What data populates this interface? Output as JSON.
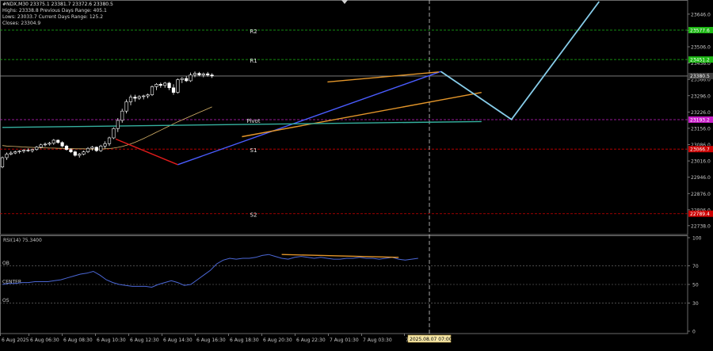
{
  "header": {
    "symbol_line": "#NDX,M30  23375.1  23381.7  23372.6  23380.5",
    "row2": "Highs: 23338.8     Previous Days Range: 405.1",
    "row3": "Lows: 23033.7      Current Days Range: 125.2",
    "row4": "Closes: 23304.9"
  },
  "chart_data": [
    {
      "type": "candlestick",
      "title": "#NDX,M30",
      "ylim": [
        22700,
        23700
      ],
      "y_ticks": [
        23646.0,
        23576.0,
        23506.0,
        23436.0,
        23366.0,
        23296.0,
        23226.0,
        23156.0,
        23086.0,
        23016.0,
        22946.0,
        22876.0,
        22806.0,
        22738.0
      ],
      "x_tick_labels": [
        "6 Aug 2025",
        "6 Aug 06:30",
        "6 Aug 08:30",
        "6 Aug 10:30",
        "6 Aug 12:30",
        "6 Aug 14:30",
        "6 Aug 16:30",
        "6 Aug 18:30",
        "6 Aug 20:30",
        "6 Aug 22:30",
        "7 Aug 01:30",
        "7 Aug 03:30",
        "7"
      ],
      "crosshair_time_label": "2025.08.07 07:00",
      "price_tags": [
        {
          "value": "23577.6",
          "color": "#1db814"
        },
        {
          "value": "23451.2",
          "color": "#1db814"
        },
        {
          "value": "23380.5",
          "color": "#3c3c3c"
        },
        {
          "value": "23193.2",
          "color": "#c71ec7"
        },
        {
          "value": "23066.7",
          "color": "#cc0000"
        },
        {
          "value": "22789.4",
          "color": "#cc0000"
        }
      ],
      "levels": [
        {
          "name": "R2",
          "value": 23577.6,
          "color": "#1db814"
        },
        {
          "name": "R1",
          "value": 23451.2,
          "color": "#1db814"
        },
        {
          "name": "Pivot",
          "value": 23193.2,
          "color": "#c71ec7"
        },
        {
          "name": "S1",
          "value": 23066.7,
          "color": "#cc0000"
        },
        {
          "name": "S2",
          "value": 22789.4,
          "color": "#cc0000"
        }
      ],
      "current_price": 23380.5,
      "candles": [
        [
          22990,
          23035,
          22985,
          23030
        ],
        [
          23030,
          23052,
          23020,
          23045
        ],
        [
          23045,
          23058,
          23040,
          23050
        ],
        [
          23050,
          23060,
          23045,
          23055
        ],
        [
          23055,
          23062,
          23048,
          23058
        ],
        [
          23058,
          23066,
          23050,
          23062
        ],
        [
          23062,
          23070,
          23055,
          23060
        ],
        [
          23060,
          23068,
          23052,
          23065
        ],
        [
          23065,
          23080,
          23060,
          23075
        ],
        [
          23075,
          23090,
          23070,
          23085
        ],
        [
          23085,
          23095,
          23078,
          23088
        ],
        [
          23088,
          23098,
          23082,
          23092
        ],
        [
          23092,
          23110,
          23085,
          23105
        ],
        [
          23105,
          23108,
          23090,
          23095
        ],
        [
          23095,
          23100,
          23075,
          23080
        ],
        [
          23080,
          23085,
          23060,
          23065
        ],
        [
          23065,
          23070,
          23050,
          23055
        ],
        [
          23055,
          23060,
          23035,
          23040
        ],
        [
          23040,
          23050,
          23030,
          23045
        ],
        [
          23045,
          23060,
          23040,
          23055
        ],
        [
          23055,
          23075,
          23050,
          23070
        ],
        [
          23070,
          23080,
          23060,
          23075
        ],
        [
          23075,
          23078,
          23055,
          23060
        ],
        [
          23060,
          23085,
          23055,
          23080
        ],
        [
          23080,
          23100,
          23070,
          23090
        ],
        [
          23090,
          23120,
          23080,
          23115
        ],
        [
          23115,
          23160,
          23110,
          23155
        ],
        [
          23155,
          23200,
          23140,
          23190
        ],
        [
          23190,
          23240,
          23180,
          23230
        ],
        [
          23230,
          23280,
          23220,
          23270
        ],
        [
          23270,
          23300,
          23255,
          23290
        ],
        [
          23290,
          23300,
          23270,
          23285
        ],
        [
          23285,
          23298,
          23278,
          23292
        ],
        [
          23292,
          23300,
          23280,
          23295
        ],
        [
          23295,
          23305,
          23285,
          23300
        ],
        [
          23300,
          23340,
          23295,
          23335
        ],
        [
          23335,
          23350,
          23320,
          23345
        ],
        [
          23345,
          23352,
          23330,
          23340
        ],
        [
          23340,
          23355,
          23330,
          23350
        ],
        [
          23350,
          23355,
          23320,
          23330
        ],
        [
          23330,
          23345,
          23300,
          23310
        ],
        [
          23310,
          23370,
          23305,
          23365
        ],
        [
          23365,
          23375,
          23350,
          23370
        ],
        [
          23370,
          23380,
          23355,
          23360
        ],
        [
          23360,
          23395,
          23355,
          23385
        ],
        [
          23385,
          23400,
          23375,
          23392
        ],
        [
          23392,
          23398,
          23380,
          23385
        ],
        [
          23385,
          23395,
          23375,
          23390
        ],
        [
          23390,
          23398,
          23378,
          23385
        ],
        [
          23385,
          23392,
          23372,
          23381
        ]
      ],
      "trend_lines": [
        {
          "color": "#e11b1b",
          "points": [
            [
              26.5,
              23110
            ],
            [
              41,
              23000
            ]
          ]
        },
        {
          "color": "#4a5cff",
          "points": [
            [
              41,
              23000
            ],
            [
              102.5,
              23400
            ]
          ]
        },
        {
          "color": "#e4962a",
          "points": [
            [
              76,
              23355
            ],
            [
              102,
              23398
            ]
          ]
        },
        {
          "color": "#e4962a",
          "points": [
            [
              56,
              23120
            ],
            [
              112,
              23310
            ]
          ]
        },
        {
          "color": "#35b1a0",
          "points": [
            [
              0,
              23160
            ],
            [
              112,
              23185
            ]
          ]
        },
        {
          "color": "#87cdea",
          "points": [
            [
              102.5,
              23400
            ],
            [
              119,
              23194
            ],
            [
              139.5,
              23700
            ]
          ]
        }
      ],
      "ma": {
        "color": "#d8b46a",
        "values": [
          23082,
          23080,
          23079,
          23078,
          23077,
          23076,
          23075,
          23074,
          23073,
          23073,
          23072,
          23071,
          23071,
          23070,
          23070,
          23069,
          23069,
          23068,
          23068,
          23068,
          23067,
          23067,
          23067,
          23067,
          23068,
          23069,
          23071,
          23074,
          23078,
          23083,
          23089,
          23096,
          23104,
          23112,
          23121,
          23130,
          23139,
          23148,
          23157,
          23166,
          23175,
          23184,
          23192,
          23200,
          23208,
          23216,
          23224,
          23232,
          23240,
          23248
        ]
      }
    },
    {
      "type": "line",
      "title": "RSI(14) 75.3400",
      "ylim": [
        0,
        100
      ],
      "y_ticks": [
        100,
        70,
        50,
        30,
        0
      ],
      "levels": [
        {
          "name": "OB",
          "value": 70
        },
        {
          "name": "CENTER",
          "value": 50
        },
        {
          "name": "OS",
          "value": 30
        }
      ],
      "series": [
        {
          "color": "#4b67d6",
          "values": [
            50,
            51,
            51,
            52,
            52,
            53,
            53,
            53,
            54,
            55,
            57,
            59,
            61,
            62,
            64,
            60,
            55,
            52,
            50,
            49,
            48,
            48,
            48,
            47,
            50,
            52,
            54,
            52,
            49,
            50,
            55,
            60,
            65,
            72,
            76,
            78,
            77,
            78,
            78,
            79,
            81,
            82,
            80,
            78,
            77,
            79,
            80,
            79,
            78,
            79,
            78,
            77,
            77,
            78,
            78,
            79,
            78,
            78,
            77,
            78,
            79,
            77,
            76,
            77,
            78
          ]
        }
      ],
      "divergence_line": {
        "color": "#e4962a",
        "points": [
          [
            43,
            82
          ],
          [
            61,
            79
          ]
        ]
      }
    }
  ]
}
